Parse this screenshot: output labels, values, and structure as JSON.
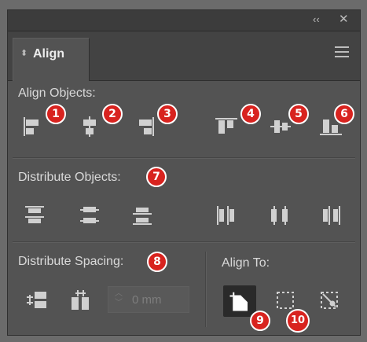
{
  "titlebar": {
    "collapse_icon": "double-chevron-left-icon",
    "close_icon": "close-icon",
    "collapse_glyph": "‹‹",
    "close_glyph": "✕"
  },
  "tab": {
    "title": "Align",
    "arrow": "⬍"
  },
  "sections": {
    "align_objects": "Align Objects:",
    "distribute_objects": "Distribute Objects:",
    "distribute_spacing": "Distribute Spacing:",
    "align_to": "Align To:"
  },
  "align_objects_buttons": [
    {
      "icon": "align-left-edges-icon"
    },
    {
      "icon": "align-horizontal-centers-icon"
    },
    {
      "icon": "align-right-edges-icon"
    },
    {
      "icon": "align-top-edges-icon"
    },
    {
      "icon": "align-vertical-centers-icon"
    },
    {
      "icon": "align-bottom-edges-icon"
    }
  ],
  "distribute_objects_buttons": [
    {
      "icon": "distribute-top-edges-icon"
    },
    {
      "icon": "distribute-vertical-centers-icon"
    },
    {
      "icon": "distribute-bottom-edges-icon"
    },
    {
      "icon": "distribute-left-edges-icon"
    },
    {
      "icon": "distribute-horizontal-centers-icon"
    },
    {
      "icon": "distribute-right-edges-icon"
    }
  ],
  "distribute_spacing": {
    "vertical_icon": "vertical-distribute-space-icon",
    "horizontal_icon": "horizontal-distribute-space-icon",
    "value": "0 mm",
    "stepper_up": "︿",
    "stepper_down": "﹀"
  },
  "align_to_buttons": [
    {
      "icon": "align-to-artboard-icon",
      "active": true
    },
    {
      "icon": "align-to-selection-icon",
      "active": false
    },
    {
      "icon": "align-to-key-object-icon",
      "active": false
    }
  ],
  "badges": [
    "1",
    "2",
    "3",
    "4",
    "5",
    "6",
    "7",
    "8",
    "9",
    "10"
  ],
  "colors": {
    "panel": "#535353",
    "badge": "#d8231f",
    "titlebar": "#3c3c3c",
    "active_button": "#2a2a2a"
  }
}
